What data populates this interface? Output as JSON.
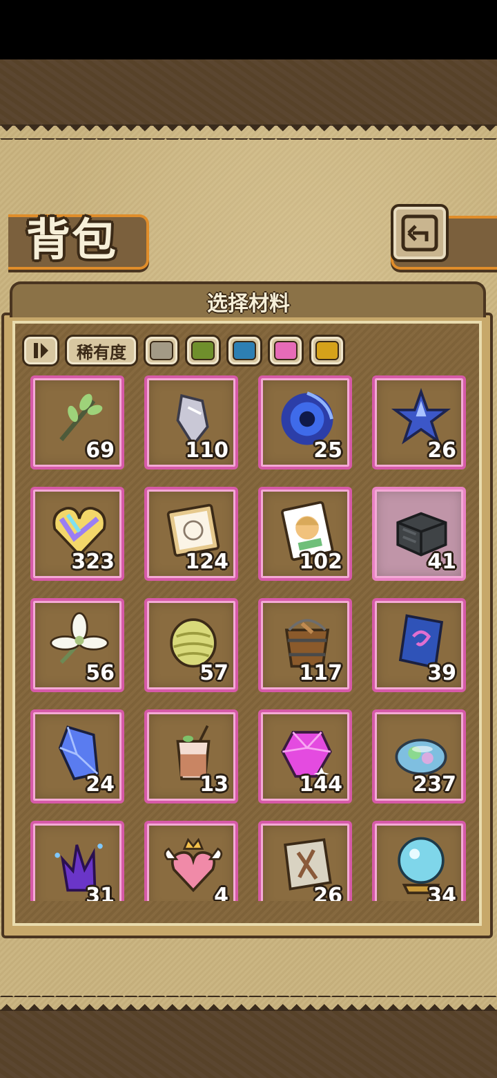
{
  "header": {
    "title": "背包",
    "back_icon": "return-arrow-icon"
  },
  "panel": {
    "title": "选择材料",
    "filter": {
      "sort_icon": "sort-toggle-icon",
      "rarity_label": "稀有度",
      "colors": [
        "#a39a86",
        "#6f8f2c",
        "#2d7fb3",
        "#e76bb7",
        "#d5a21a"
      ]
    }
  },
  "items": [
    {
      "icon": "twig-sprout-icon",
      "qty": "69"
    },
    {
      "icon": "silver-shard-icon",
      "qty": "110"
    },
    {
      "icon": "blue-vortex-icon",
      "qty": "25"
    },
    {
      "icon": "blue-star-crystal-icon",
      "qty": "26"
    },
    {
      "icon": "rainbow-heart-gem-icon",
      "qty": "323"
    },
    {
      "icon": "sketch-portrait-card-icon",
      "qty": "124"
    },
    {
      "icon": "character-photo-card-icon",
      "qty": "102"
    },
    {
      "icon": "dark-crate-icon",
      "qty": "41"
    },
    {
      "icon": "white-flower-icon",
      "qty": "56"
    },
    {
      "icon": "hop-cone-icon",
      "qty": "57"
    },
    {
      "icon": "wooden-bucket-icon",
      "qty": "117"
    },
    {
      "icon": "blue-rune-tile-icon",
      "qty": "39"
    },
    {
      "icon": "blue-crystal-icon",
      "qty": "24"
    },
    {
      "icon": "iced-drink-icon",
      "qty": "13"
    },
    {
      "icon": "pink-gem-icon",
      "qty": "144"
    },
    {
      "icon": "opal-stone-icon",
      "qty": "237"
    },
    {
      "icon": "purple-crystal-cluster-icon",
      "qty": "31"
    },
    {
      "icon": "winged-heart-crown-icon",
      "qty": "4"
    },
    {
      "icon": "torn-map-icon",
      "qty": "26"
    },
    {
      "icon": "crystal-ball-icon",
      "qty": "34"
    }
  ]
}
